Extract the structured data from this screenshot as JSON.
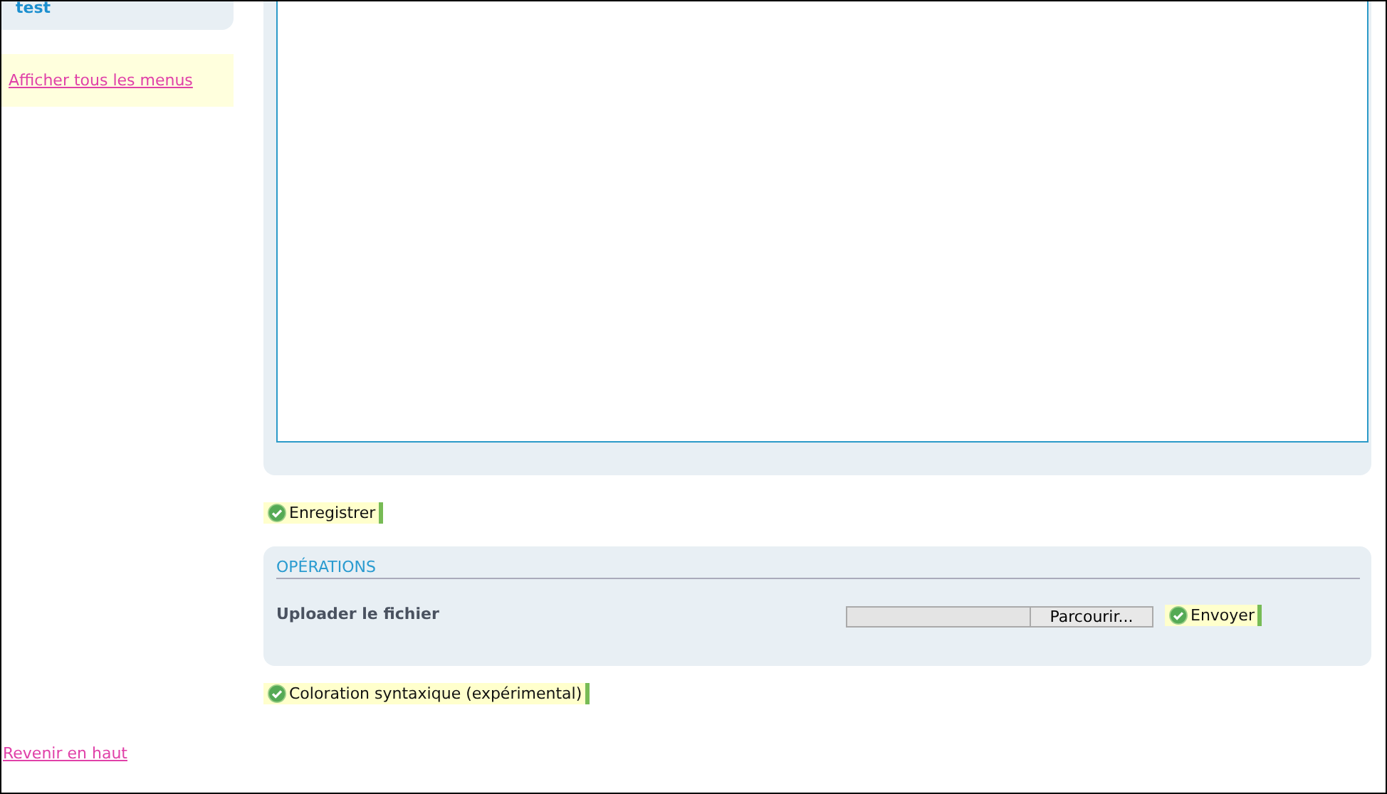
{
  "sidebar": {
    "menu_title": "test",
    "show_all_link": "Afficher tous les menus",
    "back_to_top_link": "Revenir en haut"
  },
  "editor": {
    "save_button": "Enregistrer"
  },
  "operations": {
    "title": "OPÉRATIONS",
    "upload_label": "Uploader le fichier",
    "browse_button": "Parcourir...",
    "send_button": "Envoyer"
  },
  "syntax_button": "Coloration syntaxique (expérimental)"
}
